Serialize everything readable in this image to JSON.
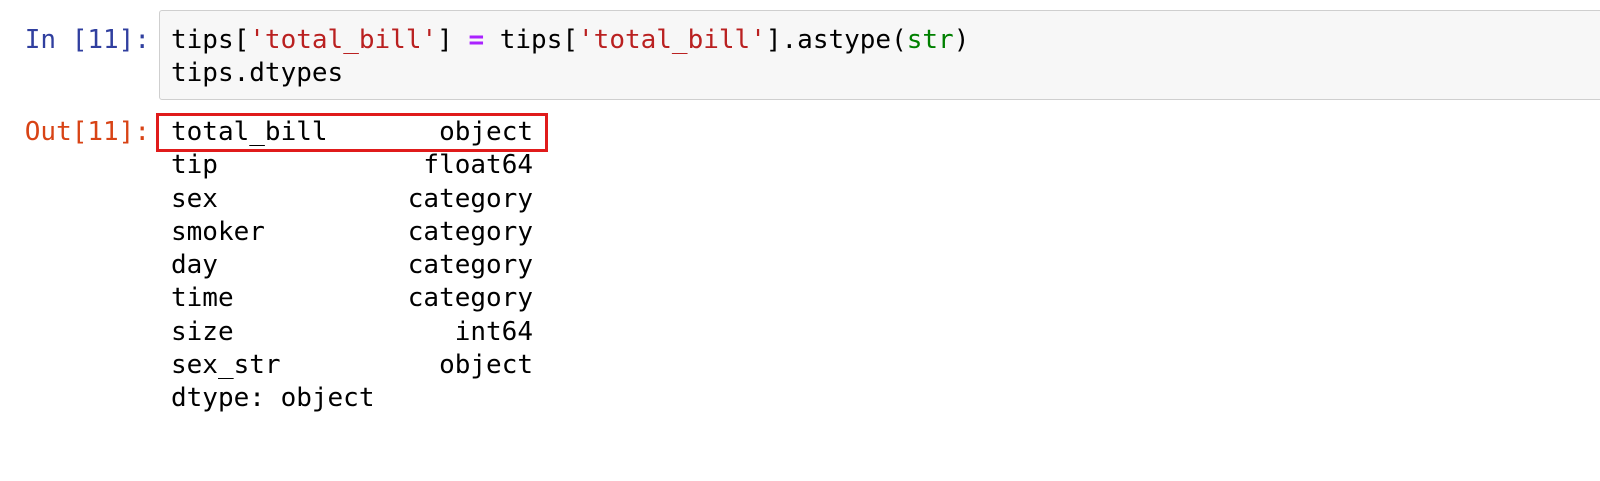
{
  "input_cell": {
    "prompt": "In [11]:",
    "line1": {
      "p1": "tips[",
      "s1": "'total_bill'",
      "p2": "] ",
      "op": "=",
      "p3": " tips[",
      "s2": "'total_bill'",
      "p4": "].astype(",
      "builtin": "str",
      "p5": ")"
    },
    "line2": "tips.dtypes"
  },
  "output_cell": {
    "prompt": "Out[11]:",
    "rows": [
      {
        "name": "total_bill",
        "dtype": "object"
      },
      {
        "name": "tip",
        "dtype": "float64"
      },
      {
        "name": "sex",
        "dtype": "category"
      },
      {
        "name": "smoker",
        "dtype": "category"
      },
      {
        "name": "day",
        "dtype": "category"
      },
      {
        "name": "time",
        "dtype": "category"
      },
      {
        "name": "size",
        "dtype": "int64"
      },
      {
        "name": "sex_str",
        "dtype": "object"
      }
    ],
    "footer": "dtype: object"
  },
  "colors": {
    "in_prompt": "#303f9f",
    "out_prompt": "#d84315",
    "string": "#ba2121",
    "operator": "#aa22ff",
    "builtin": "#008000",
    "highlight_box": "#e01b1b",
    "input_background": "#f7f7f7"
  }
}
